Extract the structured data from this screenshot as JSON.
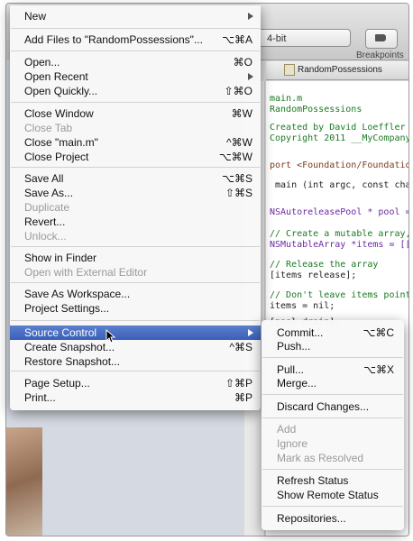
{
  "background": {
    "scheme_text": "4-bit",
    "breakpoints_label": "Breakpoints",
    "jumpbar_file": "RandomPossessions",
    "code_lines": [
      {
        "text": "main.m",
        "kind": "comment"
      },
      {
        "text": "RandomPossessions",
        "kind": "comment"
      },
      {
        "text": "",
        "kind": "plain"
      },
      {
        "text": "Created by David Loeffler",
        "kind": "comment"
      },
      {
        "text": "Copyright 2011 __MyCompany",
        "kind": "comment"
      },
      {
        "text": "",
        "kind": "plain"
      },
      {
        "text": "port <Foundation/Foundation",
        "kind": "pre"
      },
      {
        "text": "",
        "kind": "plain"
      },
      {
        "text": " main (int argc, const char",
        "kind": "plain"
      },
      {
        "text": "",
        "kind": "plain"
      },
      {
        "text": "NSAutoreleasePool * pool =",
        "kind": "type"
      },
      {
        "text": "",
        "kind": "plain"
      },
      {
        "text": "// Create a mutable array,",
        "kind": "comment"
      },
      {
        "text": "NSMutableArray *items = [[",
        "kind": "type"
      },
      {
        "text": "",
        "kind": "plain"
      },
      {
        "text": "// Release the array",
        "kind": "comment"
      },
      {
        "text": "[items release];",
        "kind": "plain"
      },
      {
        "text": "",
        "kind": "plain"
      },
      {
        "text": "// Don't leave items point",
        "kind": "comment"
      },
      {
        "text": "items = nil;",
        "kind": "plain"
      },
      {
        "text": "",
        "kind": "plain"
      },
      {
        "text": "[pool drain];",
        "kind": "plain"
      }
    ]
  },
  "file_menu": {
    "items": [
      {
        "label": "New",
        "shortcut": "",
        "submenu": true,
        "disabled": false
      },
      {
        "label": "Add Files to \"RandomPossessions\"...",
        "shortcut": "⌥⌘A",
        "submenu": false,
        "disabled": false
      },
      {
        "label": "Open...",
        "shortcut": "⌘O",
        "submenu": false,
        "disabled": false
      },
      {
        "label": "Open Recent",
        "shortcut": "",
        "submenu": true,
        "disabled": false
      },
      {
        "label": "Open Quickly...",
        "shortcut": "⇧⌘O",
        "submenu": false,
        "disabled": false
      },
      {
        "label": "Close Window",
        "shortcut": "⌘W",
        "submenu": false,
        "disabled": false
      },
      {
        "label": "Close Tab",
        "shortcut": "",
        "submenu": false,
        "disabled": true
      },
      {
        "label": "Close \"main.m\"",
        "shortcut": "^⌘W",
        "submenu": false,
        "disabled": false
      },
      {
        "label": "Close Project",
        "shortcut": "⌥⌘W",
        "submenu": false,
        "disabled": false
      },
      {
        "label": "Save All",
        "shortcut": "⌥⌘S",
        "submenu": false,
        "disabled": false
      },
      {
        "label": "Save As...",
        "shortcut": "⇧⌘S",
        "submenu": false,
        "disabled": false
      },
      {
        "label": "Duplicate",
        "shortcut": "",
        "submenu": false,
        "disabled": true
      },
      {
        "label": "Revert...",
        "shortcut": "",
        "submenu": false,
        "disabled": false
      },
      {
        "label": "Unlock...",
        "shortcut": "",
        "submenu": false,
        "disabled": true
      },
      {
        "label": "Show in Finder",
        "shortcut": "",
        "submenu": false,
        "disabled": false
      },
      {
        "label": "Open with External Editor",
        "shortcut": "",
        "submenu": false,
        "disabled": true
      },
      {
        "label": "Save As Workspace...",
        "shortcut": "",
        "submenu": false,
        "disabled": false
      },
      {
        "label": "Project Settings...",
        "shortcut": "",
        "submenu": false,
        "disabled": false
      },
      {
        "label": "Source Control",
        "shortcut": "",
        "submenu": true,
        "disabled": false,
        "highlighted": true
      },
      {
        "label": "Create Snapshot...",
        "shortcut": "^⌘S",
        "submenu": false,
        "disabled": false
      },
      {
        "label": "Restore Snapshot...",
        "shortcut": "",
        "submenu": false,
        "disabled": false
      },
      {
        "label": "Page Setup...",
        "shortcut": "⇧⌘P",
        "submenu": false,
        "disabled": false
      },
      {
        "label": "Print...",
        "shortcut": "⌘P",
        "submenu": false,
        "disabled": false
      }
    ]
  },
  "source_control_menu": {
    "items": [
      {
        "label": "Commit...",
        "shortcut": "⌥⌘C",
        "disabled": false
      },
      {
        "label": "Push...",
        "shortcut": "",
        "disabled": false
      },
      {
        "label": "Pull...",
        "shortcut": "⌥⌘X",
        "disabled": false
      },
      {
        "label": "Merge...",
        "shortcut": "",
        "disabled": false
      },
      {
        "label": "Discard Changes...",
        "shortcut": "",
        "disabled": false
      },
      {
        "label": "Add",
        "shortcut": "",
        "disabled": true
      },
      {
        "label": "Ignore",
        "shortcut": "",
        "disabled": true
      },
      {
        "label": "Mark as Resolved",
        "shortcut": "",
        "disabled": true
      },
      {
        "label": "Refresh Status",
        "shortcut": "",
        "disabled": false
      },
      {
        "label": "Show Remote Status",
        "shortcut": "",
        "disabled": false
      },
      {
        "label": "Repositories...",
        "shortcut": "",
        "disabled": false
      }
    ]
  }
}
